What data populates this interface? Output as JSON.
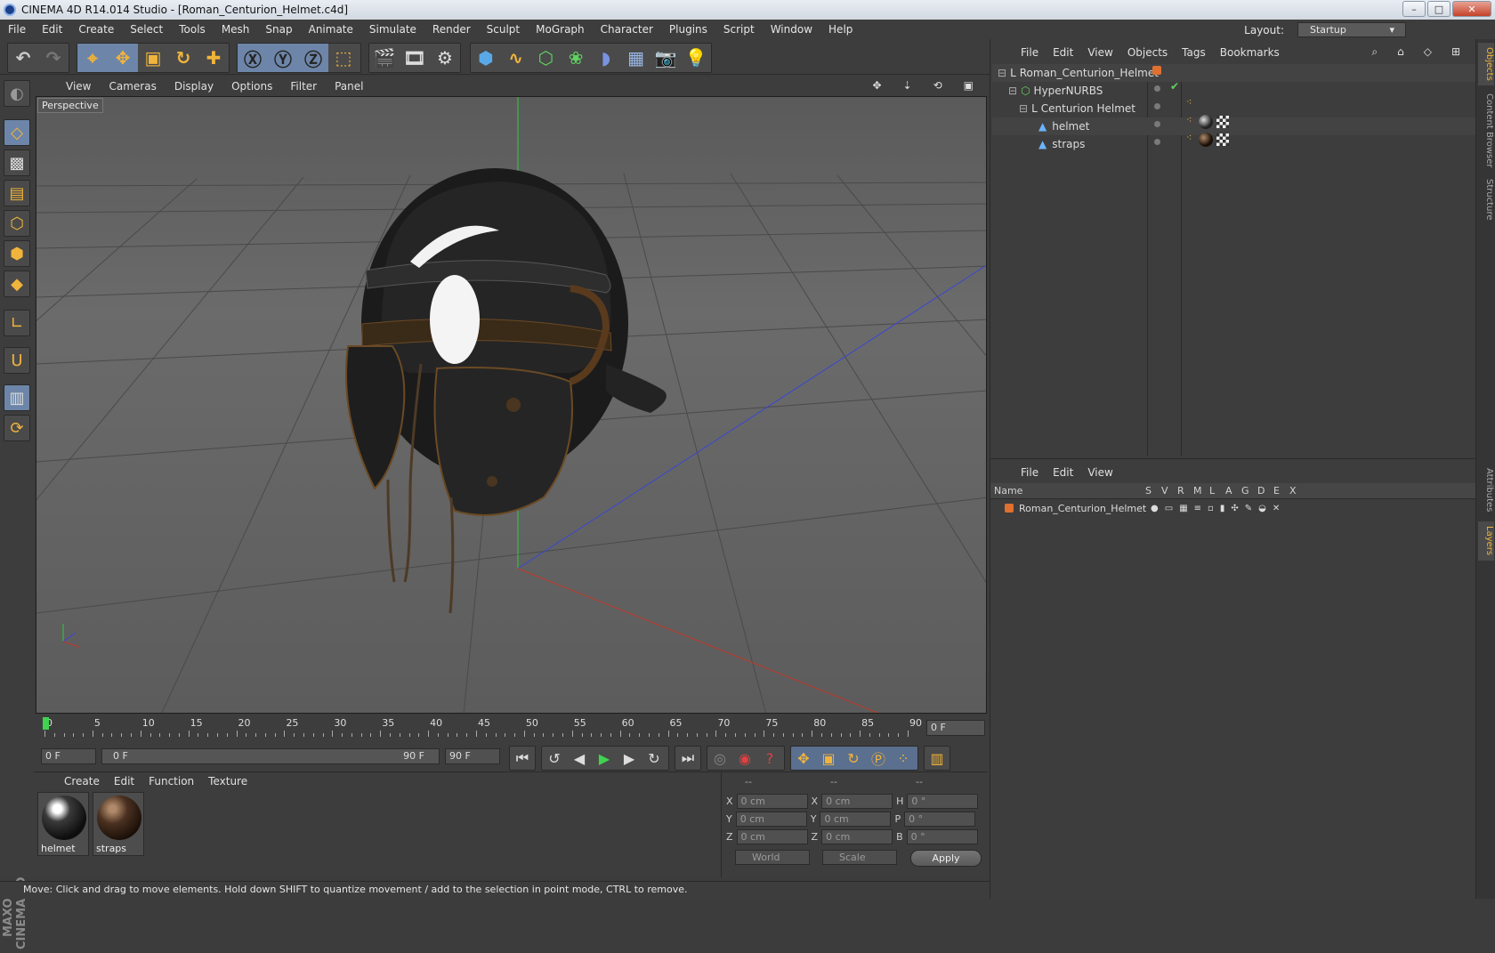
{
  "app": {
    "title": "CINEMA 4D R14.014 Studio - [Roman_Centurion_Helmet.c4d]"
  },
  "window_buttons": {
    "minimize": "–",
    "maximize": "□",
    "close": "✕"
  },
  "menubar": [
    "File",
    "Edit",
    "Create",
    "Select",
    "Tools",
    "Mesh",
    "Snap",
    "Animate",
    "Simulate",
    "Render",
    "Sculpt",
    "MoGraph",
    "Character",
    "Plugins",
    "Script",
    "Window",
    "Help"
  ],
  "layout": {
    "label": "Layout:",
    "value": "Startup"
  },
  "viewport": {
    "menu": [
      "View",
      "Cameras",
      "Display",
      "Options",
      "Filter",
      "Panel"
    ],
    "label": "Perspective"
  },
  "timeline": {
    "ticks": [
      "0",
      "5",
      "10",
      "15",
      "20",
      "25",
      "30",
      "35",
      "40",
      "45",
      "50",
      "55",
      "60",
      "65",
      "70",
      "75",
      "80",
      "85",
      "90"
    ],
    "current_frame": "0 F"
  },
  "transport": {
    "start": "0 F",
    "range_start": "0 F",
    "range_end": "90 F",
    "end": "90 F"
  },
  "material_manager": {
    "menu": [
      "Create",
      "Edit",
      "Function",
      "Texture"
    ],
    "materials": [
      {
        "name": "helmet"
      },
      {
        "name": "straps"
      }
    ]
  },
  "coordinates": {
    "header": [
      "--",
      "--",
      "--"
    ],
    "rows": [
      {
        "a": "X",
        "av": "0 cm",
        "b": "X",
        "bv": "0 cm",
        "c": "H",
        "cv": "0 °"
      },
      {
        "a": "Y",
        "av": "0 cm",
        "b": "Y",
        "bv": "0 cm",
        "c": "P",
        "cv": "0 °"
      },
      {
        "a": "Z",
        "av": "0 cm",
        "b": "Z",
        "bv": "0 cm",
        "c": "B",
        "cv": "0 °"
      }
    ],
    "space": "World",
    "mode": "Scale",
    "apply": "Apply"
  },
  "status": "Move: Click and drag to move elements. Hold down SHIFT to quantize movement / add to the selection in point mode, CTRL to remove.",
  "objects": {
    "menu": [
      "File",
      "Edit",
      "View",
      "Objects",
      "Tags",
      "Bookmarks"
    ],
    "items": [
      {
        "name": "Roman_Centurion_Helmet"
      },
      {
        "name": "HyperNURBS"
      },
      {
        "name": "Centurion Helmet"
      },
      {
        "name": "helmet"
      },
      {
        "name": "straps"
      }
    ]
  },
  "layers": {
    "menu": [
      "File",
      "Edit",
      "View"
    ],
    "columns": [
      "Name",
      "S",
      "V",
      "R",
      "M",
      "L",
      "A",
      "G",
      "D",
      "E",
      "X"
    ],
    "items": [
      {
        "name": "Roman_Centurion_Helmet"
      }
    ]
  },
  "side_tabs": [
    "Objects",
    "Content Browser",
    "Structure",
    "Attributes",
    "Layers"
  ],
  "branding": "MAXON CINEMA 4D",
  "colors": {
    "accent": "#f0b43c",
    "active": "#6d85a8",
    "x_axis": "#c0392b",
    "z_axis": "#3a48d0",
    "y_axis": "#2ecc40"
  }
}
